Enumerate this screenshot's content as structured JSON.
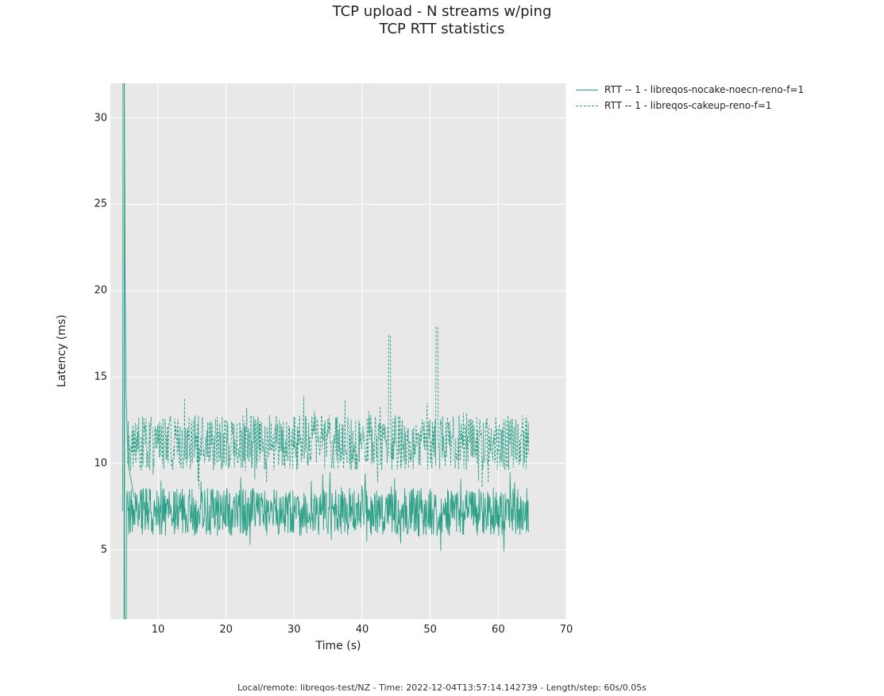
{
  "title": {
    "line1": "TCP upload - N streams w/ping",
    "line2": "TCP RTT statistics"
  },
  "axes": {
    "xlabel": "Time (s)",
    "ylabel": "Latency (ms)",
    "xlim": [
      3,
      70
    ],
    "ylim": [
      1,
      32
    ],
    "xticks": [
      10,
      20,
      30,
      40,
      50,
      60,
      70
    ],
    "yticks": [
      5,
      10,
      15,
      20,
      25,
      30
    ]
  },
  "legend": {
    "series1": "RTT -- 1 - libreqos-nocake-noecn-reno-f=1",
    "series2": "RTT -- 1 - libreqos-cakeup-reno-f=1"
  },
  "footer": "Local/remote: libreqos-test/NZ - Time: 2022-12-04T13:57:14.142739 - Length/step: 60s/0.05s",
  "chart_data": {
    "type": "line",
    "xlabel": "Time (s)",
    "ylabel": "Latency (ms)",
    "xlim": [
      3,
      70
    ],
    "ylim": [
      1,
      32
    ],
    "title": "TCP upload - N streams w/ping  TCP RTT statistics",
    "series": [
      {
        "name": "RTT -- 1 - libreqos-nocake-noecn-reno-f=1",
        "style": "solid",
        "color": "#2ca188",
        "x_range": [
          4.8,
          64.5
        ],
        "summary": {
          "trend_mean": 7.2,
          "trend_noise_amplitude": 1.4,
          "spikes": [
            {
              "x": 5.0,
              "y": 32
            },
            {
              "x": 5.2,
              "y": 1.0
            }
          ]
        }
      },
      {
        "name": "RTT -- 1 - libreqos-cakeup-reno-f=1",
        "style": "dashed",
        "color": "#2ca188",
        "x_range": [
          5.5,
          64.5
        ],
        "summary": {
          "trend_mean": 11.2,
          "trend_noise_amplitude": 1.6,
          "spikes": [
            {
              "x": 44,
              "y": 17.4
            },
            {
              "x": 51,
              "y": 17.9
            }
          ]
        }
      }
    ]
  }
}
